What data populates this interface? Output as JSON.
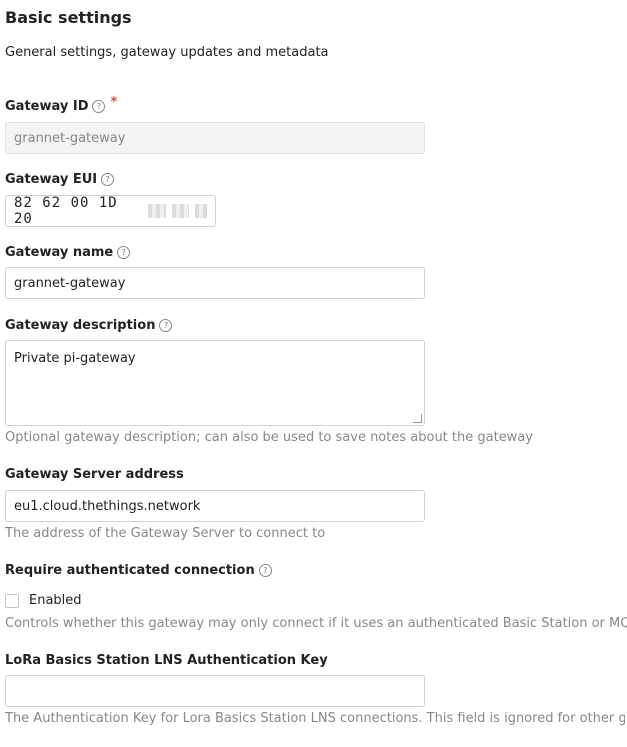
{
  "header": {
    "title": "Basic settings",
    "subtitle": "General settings, gateway updates and metadata"
  },
  "gateway_id": {
    "label": "Gateway ID",
    "required_marker": "*",
    "value": "grannet-gateway"
  },
  "gateway_eui": {
    "label": "Gateway EUI",
    "value": "82 62 00 1D 20"
  },
  "gateway_name": {
    "label": "Gateway name",
    "value": "grannet-gateway"
  },
  "gateway_description": {
    "label": "Gateway description",
    "value": "Private pi-gateway",
    "hint": "Optional gateway description; can also be used to save notes about the gateway"
  },
  "gateway_server": {
    "label": "Gateway Server address",
    "value": "eu1.cloud.thethings.network",
    "hint": "The address of the Gateway Server to connect to"
  },
  "auth_connection": {
    "label": "Require authenticated connection",
    "checkbox_label": "Enabled",
    "checked": false,
    "hint": "Controls whether this gateway may only connect if it uses an authenticated Basic Station or MQTT connectio"
  },
  "lns_key": {
    "label": "LoRa Basics Station LNS Authentication Key",
    "value": "",
    "hint": "The Authentication Key for Lora Basics Station LNS connections. This field is ignored for other gateways."
  },
  "icons": {
    "help": "help-circle-icon",
    "help_glyph": "?"
  }
}
